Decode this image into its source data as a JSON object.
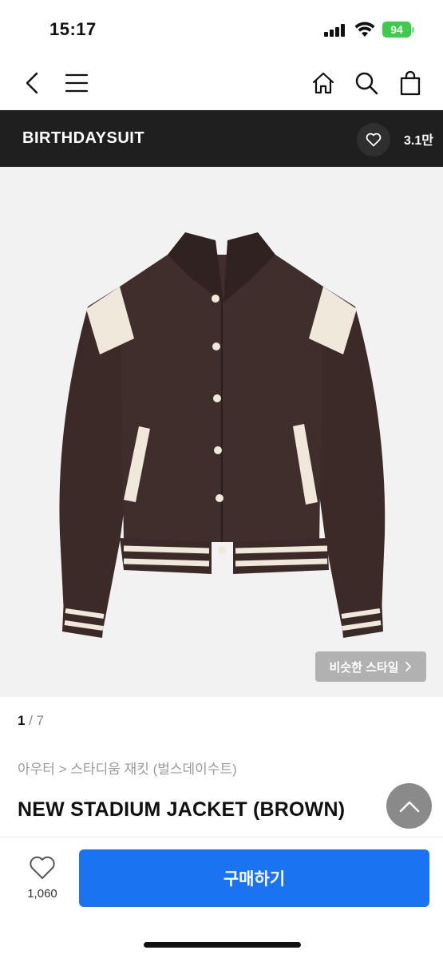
{
  "status": {
    "time": "15:17",
    "battery": "94"
  },
  "brand": {
    "name": "BIRTHDAYSUIT",
    "like_count": "3.1만"
  },
  "hero": {
    "similar_style_label": "비슷한 스타일"
  },
  "pager": {
    "current": "1",
    "separator": " / ",
    "total": "7"
  },
  "product": {
    "breadcrumb": "아우터 > 스타디움 재킷 (벌스데이수트)",
    "title": "NEW STADIUM JACKET (BROWN)"
  },
  "bottom_bar": {
    "like_count": "1,060",
    "buy_label": "구매하기"
  },
  "colors": {
    "accent": "#1a73f0",
    "brand_bar": "#1f1f1f",
    "jacket_body": "#3b2a28",
    "jacket_trim": "#efe8db"
  }
}
